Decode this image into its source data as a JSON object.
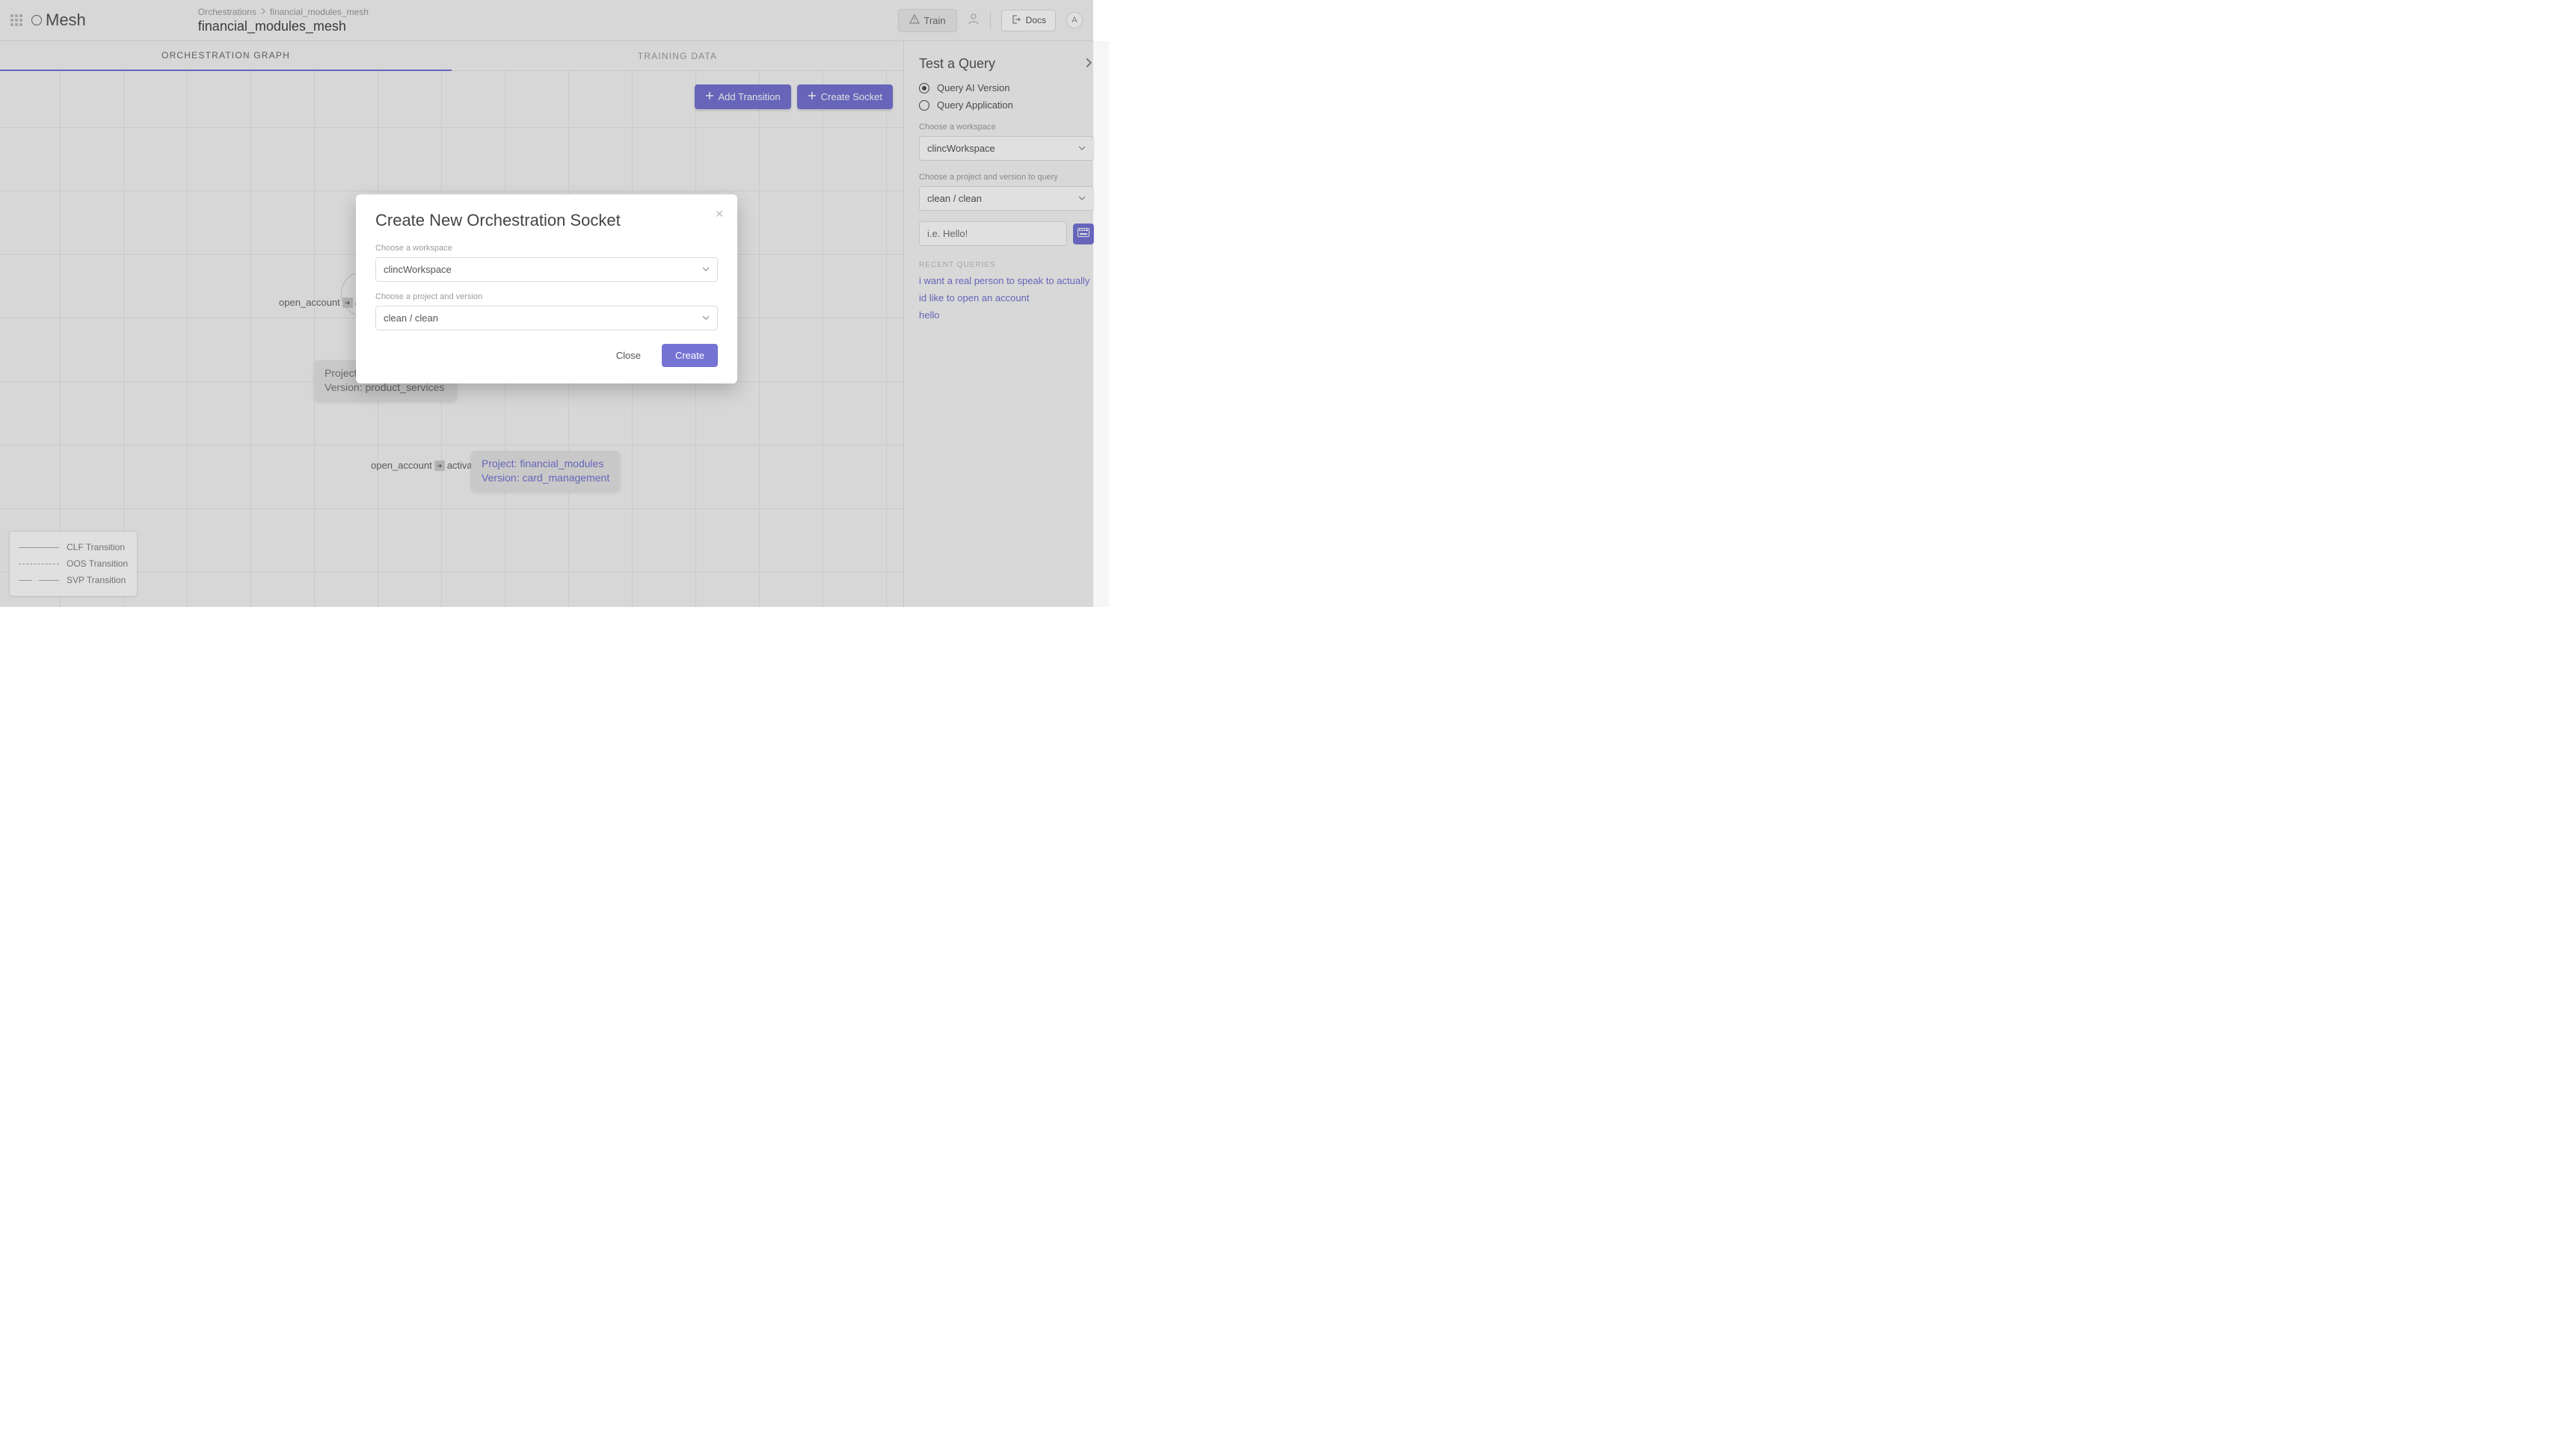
{
  "header": {
    "brand": "Mesh",
    "breadcrumb_root": "Orchestrations",
    "breadcrumb_leaf": "financial_modules_mesh",
    "page_title": "financial_modules_mesh",
    "train_label": "Train",
    "docs_label": "Docs",
    "avatar_letter": "A"
  },
  "tabs": {
    "graph": "ORCHESTRATION GRAPH",
    "training": "TRAINING DATA"
  },
  "toolbar": {
    "add_transition": "Add Transition",
    "create_socket": "Create Socket"
  },
  "canvas": {
    "edge1_source": "open_account",
    "edge1_target": "a",
    "node1_line1": "Project: financial_modules",
    "node1_line2": "Version: product_services",
    "edge2_source": "open_account",
    "edge2_target": "activate",
    "node2_line1": "Project: financial_modules",
    "node2_line2": "Version: card_management",
    "legend": {
      "clf": "CLF Transition",
      "oos": "OOS Transition",
      "svp": "SVP Transition"
    }
  },
  "side": {
    "title": "Test a Query",
    "radio_ai": "Query AI Version",
    "radio_app": "Query Application",
    "ws_label": "Choose a workspace",
    "ws_value": "clincWorkspace",
    "pv_label": "Choose a project and version to query",
    "pv_value": "clean / clean",
    "query_placeholder": "i.e. Hello!",
    "recent_h": "RECENT QUERIES",
    "recent": [
      "i want a real person to speak to actually",
      "id like to open an account",
      "hello"
    ]
  },
  "modal": {
    "title": "Create New Orchestration Socket",
    "ws_label": "Choose a workspace",
    "ws_value": "clincWorkspace",
    "pv_label": "Choose a project and version",
    "pv_value": "clean / clean",
    "close": "Close",
    "create": "Create"
  }
}
